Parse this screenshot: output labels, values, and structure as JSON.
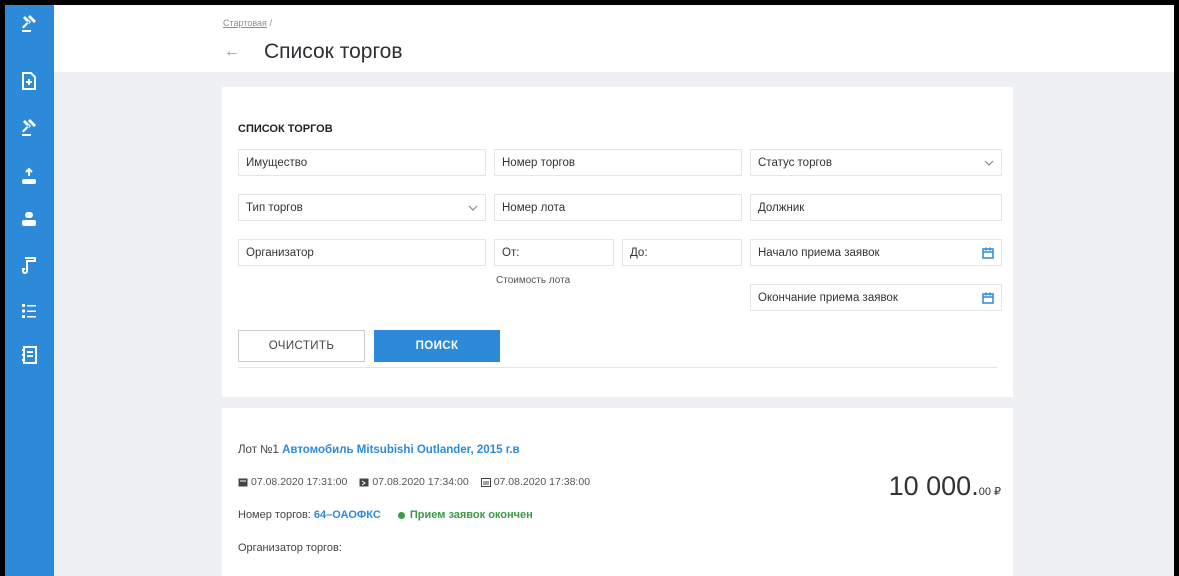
{
  "sidebar": {
    "icons": [
      "gavel-icon",
      "document-add-icon",
      "gavel-icon",
      "user-upload-icon",
      "user-list-icon",
      "scroll-icon",
      "list-icon",
      "registry-icon"
    ]
  },
  "header": {
    "breadcrumb_home": "Стартовая",
    "breadcrumb_sep": "/",
    "title": "Список торгов"
  },
  "filters": {
    "title": "СПИСОК ТОРГОВ",
    "property_placeholder": "Имущество",
    "auction_number_placeholder": "Номер торгов",
    "auction_status_placeholder": "Статус торгов",
    "auction_type_placeholder": "Тип торгов",
    "lot_number_placeholder": "Номер лота",
    "debtor_placeholder": "Должник",
    "organizer_placeholder": "Организатор",
    "price_from_placeholder": "От:",
    "price_to_placeholder": "До:",
    "lot_price_label": "Стоимость лота",
    "bid_start_placeholder": "Начало приема заявок",
    "bid_end_placeholder": "Окончание приема заявок",
    "clear_button": "ОЧИСТИТЬ",
    "search_button": "ПОИСК"
  },
  "lot": {
    "lot_prefix": "Лот №1",
    "lot_name": "Автомобиль Mitsubishi Outlander, 2015 г.в",
    "date1": "07.08.2020 17:31:00",
    "date2": "07.08.2020 17:34:00",
    "date3": "07.08.2020 17:38:00",
    "auction_number_label": "Номер торгов:",
    "auction_number": "64–ОАОФКС",
    "status": "Прием заявок окончен",
    "organizer_label": "Организатор торгов:",
    "price_main": "10 000.",
    "price_cents": "00 ₽"
  },
  "colors": {
    "accent": "#2d8ad9",
    "status_green": "#3a9b45"
  }
}
